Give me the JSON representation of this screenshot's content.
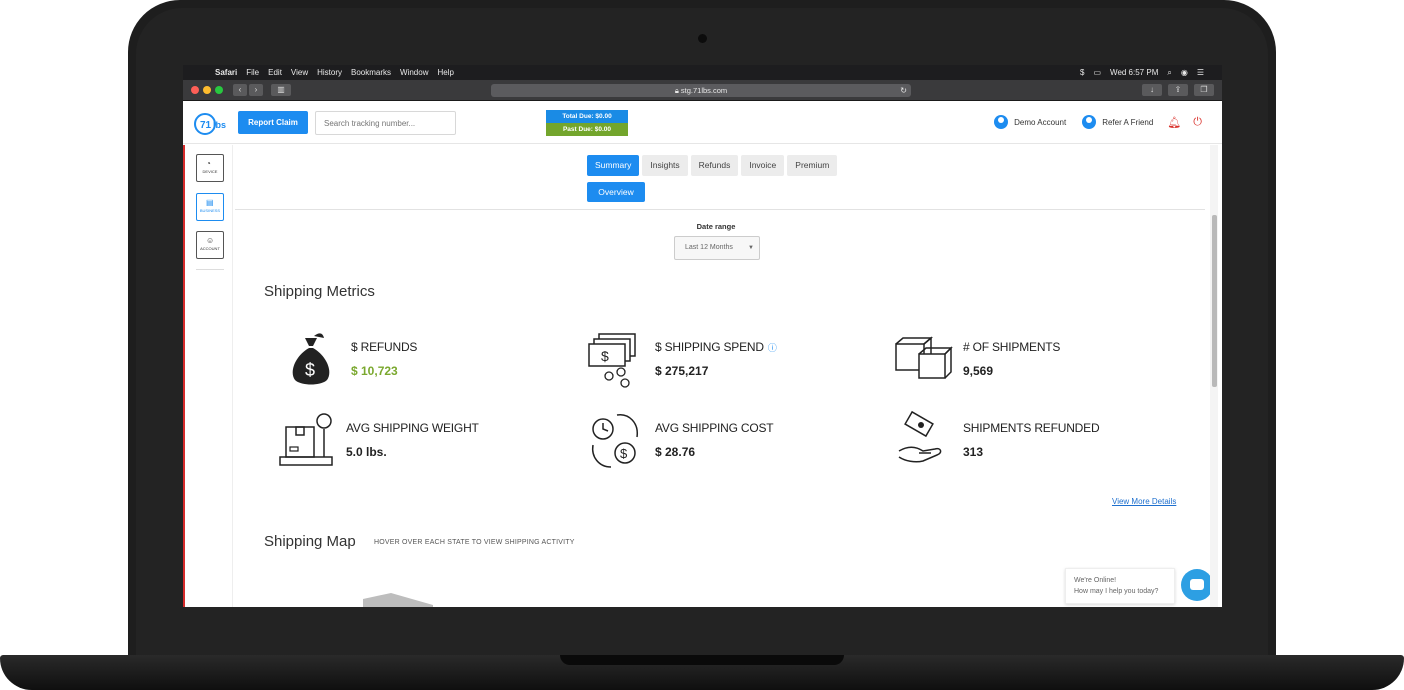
{
  "menubar": {
    "app": "Safari",
    "menus": [
      "File",
      "Edit",
      "View",
      "History",
      "Bookmarks",
      "Window",
      "Help"
    ],
    "clock": "Wed 6:57 PM"
  },
  "browser": {
    "url": "stg.71lbs.com"
  },
  "header": {
    "logo_text": "71lbs",
    "report_claim": "Report Claim",
    "search_placeholder": "Search tracking number...",
    "total_due": "Total Due: $0.00",
    "past_due": "Past Due: $0.00",
    "account": "Demo Account",
    "refer": "Refer A Friend"
  },
  "leftnav": {
    "items": [
      "DEVICE",
      "BUSINESS",
      "ACCOUNT"
    ]
  },
  "tabs": [
    "Summary",
    "Insights",
    "Refunds",
    "Invoice",
    "Premium"
  ],
  "active_tab": "Summary",
  "subtab": "Overview",
  "date_range": {
    "label": "Date range",
    "value": "Last 12 Months"
  },
  "metrics": {
    "title": "Shipping Metrics",
    "items": [
      {
        "label": "$ REFUNDS",
        "value": "$ 10,723",
        "icon": "money-bag-icon"
      },
      {
        "label": "$ SHIPPING SPEND",
        "value": "$ 275,217",
        "icon": "cash-stack-icon"
      },
      {
        "label": "# OF SHIPMENTS",
        "value": "9,569",
        "icon": "boxes-icon"
      },
      {
        "label": "AVG SHIPPING WEIGHT",
        "value": "5.0 lbs.",
        "icon": "scale-icon"
      },
      {
        "label": "AVG SHIPPING COST",
        "value": "$ 28.76",
        "icon": "clock-cost-icon"
      },
      {
        "label": "SHIPMENTS REFUNDED",
        "value": "313",
        "icon": "hand-refund-icon"
      }
    ],
    "view_more": "View More Details"
  },
  "map": {
    "title": "Shipping Map",
    "subtitle": "HOVER OVER EACH STATE TO VIEW SHIPPING ACTIVITY"
  },
  "chat": {
    "line1": "We're Online!",
    "line2": "How may I help you today?"
  },
  "colors": {
    "accent": "#1d8cf0",
    "green": "#7aa82e",
    "danger": "#d9312b"
  }
}
